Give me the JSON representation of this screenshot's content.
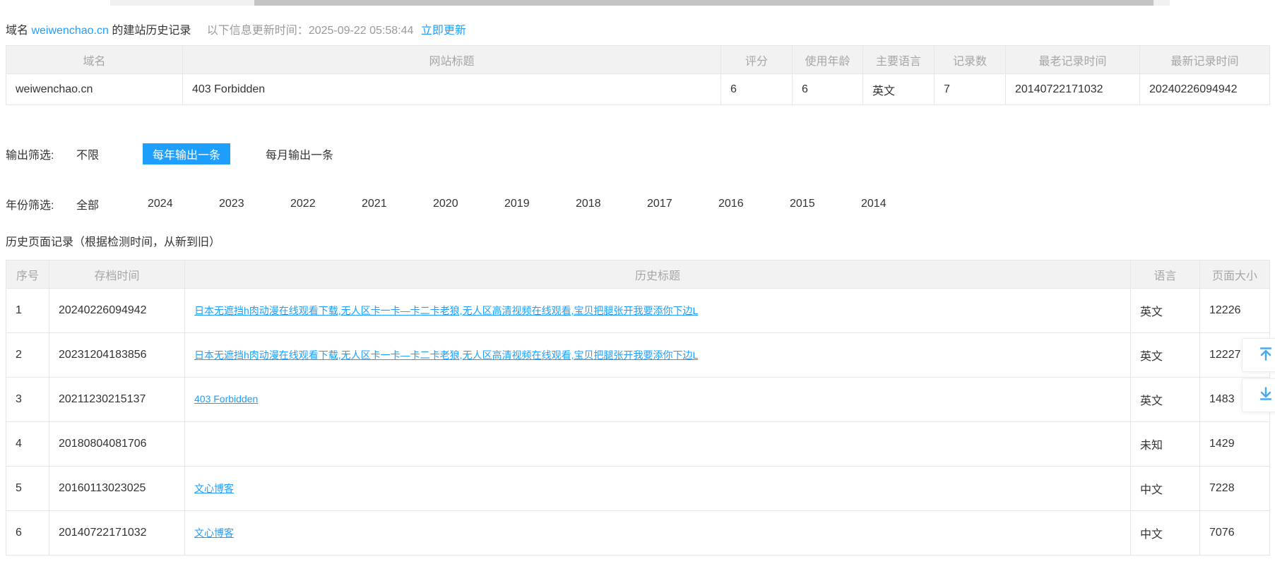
{
  "colors": {
    "accent": "#1E9FFF",
    "link": "#1E9FFF",
    "table_header_text": "#a6a6a6",
    "table_border": "#e6e6e6",
    "float_icon": "#4aa9f0"
  },
  "page": {
    "domain_label": "域名",
    "domain": "weiwenchao.cn",
    "title_suffix": "的建站历史记录",
    "update_time_label": "以下信息更新时间：",
    "update_time": "2025-09-22 05:58:44",
    "update_now": "立即更新"
  },
  "summary_table": {
    "headers": [
      "域名",
      "网站标题",
      "评分",
      "使用年龄",
      "主要语言",
      "记录数",
      "最老记录时间",
      "最新记录时间"
    ],
    "row": {
      "domain": "weiwenchao.cn",
      "site_title": "403 Forbidden",
      "score": "6",
      "age": "6",
      "language": "英文",
      "record_count": "7",
      "oldest_record": "20140722171032",
      "newest_record": "20240226094942"
    }
  },
  "output_filter": {
    "label": "输出筛选:",
    "options": [
      "不限",
      "每年输出一条",
      "每月输出一条"
    ],
    "selected": "每年输出一条"
  },
  "year_filter": {
    "label": "年份筛选:",
    "options": [
      "全部",
      "2024",
      "2023",
      "2022",
      "2021",
      "2020",
      "2019",
      "2018",
      "2017",
      "2016",
      "2015",
      "2014"
    ]
  },
  "history": {
    "heading": "历史页面记录（根据检测时间，从新到旧）",
    "headers": [
      "序号",
      "存档时间",
      "历史标题",
      "语言",
      "页面大小"
    ],
    "rows": [
      {
        "index": "1",
        "time": "20240226094942",
        "title": "日本无遮挡h肉动漫在线观看下载,无人区卡一卡—卡二卡老狼,无人区高清视频在线观看,宝贝把腿张开我要添你下边L",
        "lang": "英文",
        "size": "12226"
      },
      {
        "index": "2",
        "time": "20231204183856",
        "title": "日本无遮挡h肉动漫在线观看下载,无人区卡一卡—卡二卡老狼,无人区高清视频在线观看,宝贝把腿张开我要添你下边L",
        "lang": "英文",
        "size": "12227"
      },
      {
        "index": "3",
        "time": "20211230215137",
        "title": "403 Forbidden",
        "lang": "英文",
        "size": "1483"
      },
      {
        "index": "4",
        "time": "20180804081706",
        "title": "",
        "lang": "未知",
        "size": "1429"
      },
      {
        "index": "5",
        "time": "20160113023025",
        "title": "文心博客",
        "lang": "中文",
        "size": "7228"
      },
      {
        "index": "6",
        "time": "20140722171032",
        "title": "文心博客",
        "lang": "中文",
        "size": "7076"
      }
    ]
  }
}
